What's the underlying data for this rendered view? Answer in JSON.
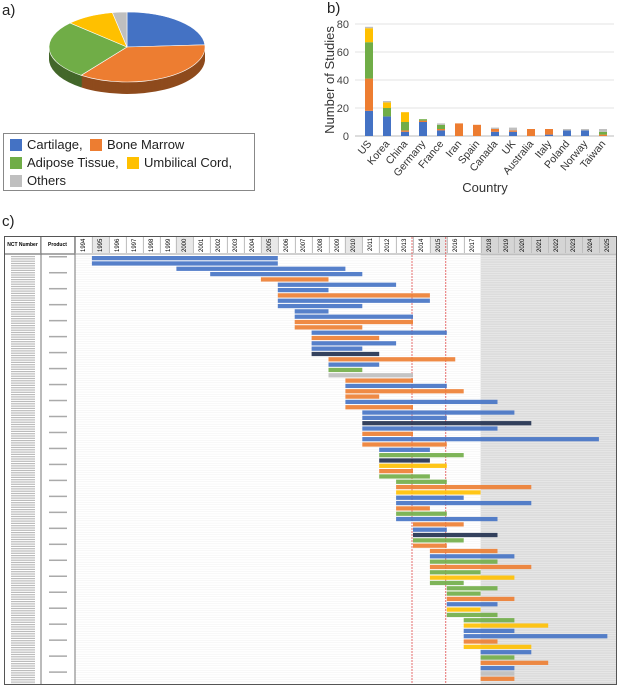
{
  "panel_labels": {
    "a": "a)",
    "b": "b)",
    "c": "c)"
  },
  "colors": {
    "Cartilage": "#4472c4",
    "Bone Marrow": "#ed7d31",
    "Adipose Tissue": "#70ad47",
    "Umbilical Cord": "#ffc000",
    "Others": "#bfbfbf",
    "Dark": "#1f2d4d"
  },
  "chart_data": [
    {
      "type": "pie",
      "legend_labels": [
        "Cartilage,",
        "Bone Marrow",
        "Adipose Tissue,",
        "Umbilical Cord,",
        "Others"
      ],
      "categories": [
        "Cartilage",
        "Bone Marrow",
        "Adipose Tissue",
        "Umbilical Cord",
        "Others"
      ],
      "values": [
        24,
        36,
        27,
        10,
        3
      ],
      "legend": "bottom"
    },
    {
      "type": "bar",
      "stacked": true,
      "xlabel": "Country",
      "ylabel": "Number of Studies",
      "ylim": [
        0,
        80
      ],
      "yticks": [
        0,
        20,
        40,
        60,
        80
      ],
      "grid": true,
      "categories": [
        "US",
        "Korea",
        "China",
        "Germany",
        "France",
        "Iran",
        "Spain",
        "Canada",
        "UK",
        "Australia",
        "Italy",
        "Poland",
        "Norway",
        "Taiwan"
      ],
      "series": [
        {
          "category": "Cartilage",
          "values": [
            18,
            14,
            3,
            10,
            4,
            0,
            0,
            3,
            3,
            0,
            1,
            4,
            4,
            0
          ]
        },
        {
          "category": "Bone Marrow",
          "values": [
            23,
            0,
            1,
            1,
            1,
            9,
            8,
            2,
            1,
            5,
            4,
            0,
            0,
            1
          ]
        },
        {
          "category": "Adipose Tissue",
          "values": [
            26,
            6,
            6,
            1,
            3,
            0,
            0,
            0,
            0,
            0,
            0,
            0,
            0,
            2
          ]
        },
        {
          "category": "Umbilical Cord",
          "values": [
            10,
            4,
            7,
            0,
            0,
            0,
            0,
            0,
            0,
            0,
            0,
            0,
            0,
            0
          ]
        },
        {
          "category": "Others",
          "values": [
            1,
            1,
            0,
            0,
            1,
            0,
            0,
            1,
            2,
            0,
            0,
            1,
            1,
            2
          ]
        }
      ]
    },
    {
      "type": "gantt",
      "headers": {
        "nct": "NCT Number",
        "product": "Product"
      },
      "years": [
        "1994",
        "1995",
        "1996",
        "1997",
        "1998",
        "1999",
        "2000",
        "2001",
        "2002",
        "2003",
        "2004",
        "2005",
        "2006",
        "2007",
        "2008",
        "2009",
        "2010",
        "2011",
        "2012",
        "2013",
        "2014",
        "2015",
        "2016",
        "2017",
        "2018",
        "2019",
        "2020",
        "2021",
        "2022",
        "2023",
        "2024",
        "2025"
      ],
      "future_shaded_from": "2018",
      "marker_years": [
        2014,
        2016
      ],
      "bars": [
        [
          1995,
          2006,
          0
        ],
        [
          1995,
          2006,
          0
        ],
        [
          2000,
          2010,
          0
        ],
        [
          2002,
          2011,
          0
        ],
        [
          2005,
          2009,
          1
        ],
        [
          2006,
          2013,
          0
        ],
        [
          2006,
          2009,
          0
        ],
        [
          2006,
          2015,
          1
        ],
        [
          2006,
          2015,
          0
        ],
        [
          2006,
          2011,
          0
        ],
        [
          2007,
          2009,
          0
        ],
        [
          2007,
          2014,
          0
        ],
        [
          2007,
          2014,
          1
        ],
        [
          2007,
          2011,
          1
        ],
        [
          2008,
          2016,
          0
        ],
        [
          2008,
          2012,
          1
        ],
        [
          2008,
          2013,
          0
        ],
        [
          2008,
          2011,
          0
        ],
        [
          2008,
          2012,
          5
        ],
        [
          2009,
          2016.5,
          1
        ],
        [
          2009,
          2012,
          0
        ],
        [
          2009,
          2011,
          2
        ],
        [
          2009,
          2014,
          4
        ],
        [
          2010,
          2014,
          1
        ],
        [
          2010,
          2016,
          0
        ],
        [
          2010,
          2017,
          1
        ],
        [
          2010,
          2012,
          1
        ],
        [
          2010,
          2019,
          0
        ],
        [
          2010,
          2014,
          1
        ],
        [
          2011,
          2020,
          0
        ],
        [
          2011,
          2016,
          0
        ],
        [
          2011,
          2021,
          5
        ],
        [
          2011,
          2019,
          0
        ],
        [
          2011,
          2014,
          1
        ],
        [
          2011,
          2025,
          0
        ],
        [
          2011,
          2016,
          1
        ],
        [
          2012,
          2015,
          0
        ],
        [
          2012,
          2017,
          2
        ],
        [
          2012,
          2015,
          5
        ],
        [
          2012,
          2016,
          3
        ],
        [
          2012,
          2014,
          1
        ],
        [
          2012,
          2015,
          2
        ],
        [
          2013,
          2016,
          2
        ],
        [
          2013,
          2021,
          1
        ],
        [
          2013,
          2018,
          3
        ],
        [
          2013,
          2017,
          0
        ],
        [
          2013,
          2021,
          0
        ],
        [
          2013,
          2015,
          1
        ],
        [
          2013,
          2016,
          2
        ],
        [
          2013,
          2019,
          0
        ],
        [
          2014,
          2017,
          1
        ],
        [
          2014,
          2016,
          0
        ],
        [
          2014,
          2019,
          5
        ],
        [
          2014,
          2017,
          2
        ],
        [
          2014,
          2016,
          1
        ],
        [
          2015,
          2019,
          1
        ],
        [
          2015,
          2020,
          0
        ],
        [
          2015,
          2019,
          2
        ],
        [
          2015,
          2021,
          1
        ],
        [
          2015,
          2018,
          2
        ],
        [
          2015,
          2020,
          3
        ],
        [
          2015,
          2017,
          2
        ],
        [
          2016,
          2019,
          2
        ],
        [
          2016,
          2018,
          2
        ],
        [
          2016,
          2020,
          1
        ],
        [
          2016,
          2019,
          0
        ],
        [
          2016,
          2018,
          3
        ],
        [
          2016,
          2019,
          2
        ],
        [
          2017,
          2020,
          2
        ],
        [
          2017,
          2022,
          3
        ],
        [
          2017,
          2020,
          0
        ],
        [
          2017,
          2025.5,
          0
        ],
        [
          2017,
          2019,
          1
        ],
        [
          2017,
          2021,
          3
        ],
        [
          2018,
          2021,
          0
        ],
        [
          2018,
          2020,
          2
        ],
        [
          2018,
          2022,
          1
        ],
        [
          2018,
          2020,
          0
        ],
        [
          2018,
          2020,
          4
        ],
        [
          2018,
          2020,
          1
        ]
      ]
    }
  ]
}
